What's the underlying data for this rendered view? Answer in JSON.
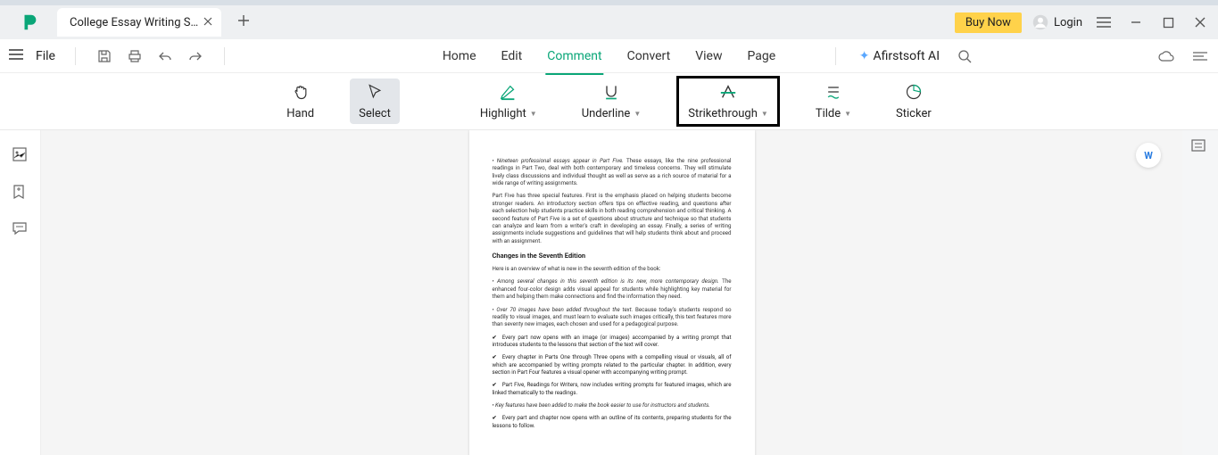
{
  "titlebar": {
    "tab_title": "College Essay Writing S…",
    "buy": "Buy Now",
    "login": "Login"
  },
  "menubar": {
    "file": "File",
    "items": [
      "Home",
      "Edit",
      "Comment",
      "Convert",
      "View",
      "Page"
    ],
    "active_index": 2,
    "ai": "Afirstsoft AI"
  },
  "toolbar": {
    "hand": "Hand",
    "select": "Select",
    "highlight": "Highlight",
    "underline": "Underline",
    "strike": "Strikethrough",
    "tilde": "Tilde",
    "sticker": "Sticker"
  },
  "document": {
    "p1_prefix": "• Nineteen professional essays appear in Part Five.",
    "p1_rest": " These essays, like the nine professional readings in Part Two, deal with both contemporary and timeless concerns. They will stimulate lively class discussions and individual thought as well as serve as a rich source of material for a wide range of writing assignments.",
    "p2": "Part Five has three special features. First is the emphasis placed on helping students become stronger readers. An introductory section offers tips on effective reading, and questions after each selection help students practice skills in both reading comprehension and critical thinking. A second feature of Part Five is a set of questions about structure and technique so that students can analyze and learn from a writer's craft in developing an essay. Finally, a series of writing assignments include suggestions and guidelines that will help students think about and proceed with an assignment.",
    "heading": "Changes in the Seventh Edition",
    "overview": "Here is an overview of what is new in the seventh edition of the book:",
    "p3_prefix": "• Among several changes in this seventh edition is its new, more contemporary design.",
    "p3_rest": " The enhanced four-color design adds visual appeal for students while highlighting key material for them and helping them make connections and find the information they need.",
    "p4_prefix": "• Over 70 images have been added throughout the text.",
    "p4_rest": " Because today's students respond so readily to visual images, and must learn to evaluate such images critically, this text features more than seventy new images, each chosen and used for a pedagogical purpose.",
    "c1": "Every part now opens with an image (or images) accompanied by a writing prompt that introduces students to the lessons that section of the text will cover.",
    "c2": "Every chapter in Parts One through Three opens with a compelling visual or visuals, all of which are accompanied by writing prompts related to the particular chapter. In addition, every section in Part Four features a visual opener with accompanying writing prompt.",
    "c3": "Part Five, Readings for Writers, now includes writing prompts for featured images, which are linked thematically to the readings.",
    "p5": "• Key features have been added to make the book easier to use for instructors and students.",
    "c4": "Every part and chapter now opens with an outline of its contents, preparing students for the lessons to follow."
  },
  "badge": "W"
}
